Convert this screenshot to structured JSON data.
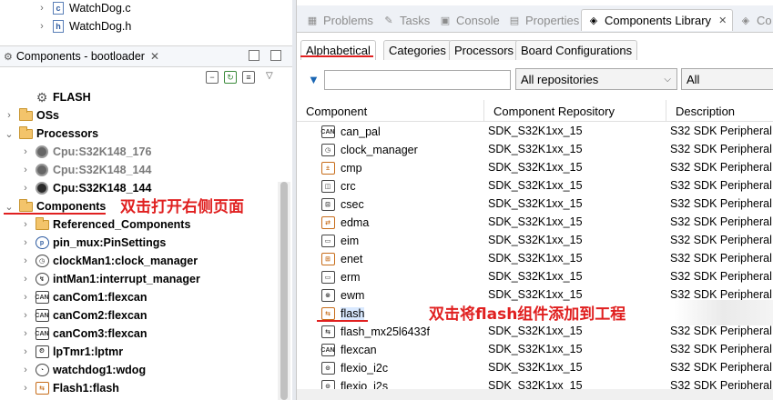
{
  "left_top_files": [
    {
      "label": "WatchDog.c",
      "icon": "c-file-icon",
      "glyph": "c"
    },
    {
      "label": "WatchDog.h",
      "icon": "h-file-icon",
      "glyph": "h"
    }
  ],
  "components_panel": {
    "title": "Components - bootloader",
    "close": "✕",
    "tree": [
      {
        "label": "FLASH",
        "icon": "gear-icon",
        "bold": true,
        "grey": false,
        "indent": 1,
        "chevron": ""
      },
      {
        "label": "OSs",
        "icon": "folder-icon",
        "bold": true,
        "grey": false,
        "indent": 0,
        "chevron": "›"
      },
      {
        "label": "Processors",
        "icon": "folder-icon",
        "bold": true,
        "grey": false,
        "indent": 0,
        "chevron": "⌄"
      },
      {
        "label": "Cpu:S32K148_176",
        "icon": "chip-icon",
        "bold": true,
        "grey": true,
        "indent": 1,
        "chevron": "›"
      },
      {
        "label": "Cpu:S32K148_144",
        "icon": "chip-icon",
        "bold": true,
        "grey": true,
        "indent": 1,
        "chevron": "›"
      },
      {
        "label": "Cpu:S32K148_144",
        "icon": "chip-icon",
        "bold": true,
        "grey": false,
        "indent": 1,
        "chevron": "›"
      },
      {
        "label": "Components",
        "icon": "folder-icon",
        "bold": true,
        "grey": false,
        "indent": 0,
        "chevron": "⌄"
      },
      {
        "label": "Referenced_Components",
        "icon": "folder-icon",
        "bold": true,
        "grey": false,
        "indent": 1,
        "chevron": "›"
      },
      {
        "label": "pin_mux:PinSettings",
        "icon": "pin-icon",
        "bold": true,
        "grey": false,
        "indent": 1,
        "chevron": "›"
      },
      {
        "label": "clockMan1:clock_manager",
        "icon": "clock-icon",
        "bold": true,
        "grey": false,
        "indent": 1,
        "chevron": "›"
      },
      {
        "label": "intMan1:interrupt_manager",
        "icon": "interrupt-icon",
        "bold": true,
        "grey": false,
        "indent": 1,
        "chevron": "›"
      },
      {
        "label": "canCom1:flexcan",
        "icon": "can-icon",
        "bold": true,
        "grey": false,
        "indent": 1,
        "chevron": "›"
      },
      {
        "label": "canCom2:flexcan",
        "icon": "can-icon",
        "bold": true,
        "grey": false,
        "indent": 1,
        "chevron": "›"
      },
      {
        "label": "canCom3:flexcan",
        "icon": "can-icon",
        "bold": true,
        "grey": false,
        "indent": 1,
        "chevron": "›"
      },
      {
        "label": "lpTmr1:lptmr",
        "icon": "timer-icon",
        "bold": true,
        "grey": false,
        "indent": 1,
        "chevron": "›"
      },
      {
        "label": "watchdog1:wdog",
        "icon": "watchdog-icon",
        "bold": true,
        "grey": false,
        "indent": 1,
        "chevron": "›"
      },
      {
        "label": "Flash1:flash",
        "icon": "flash-icon",
        "bold": true,
        "grey": false,
        "indent": 1,
        "chevron": "›"
      }
    ]
  },
  "view_tabs": [
    {
      "label": "Problems",
      "icon": "problems-icon",
      "active": false
    },
    {
      "label": "Tasks",
      "icon": "tasks-icon",
      "active": false
    },
    {
      "label": "Console",
      "icon": "console-icon",
      "active": false
    },
    {
      "label": "Properties",
      "icon": "properties-icon",
      "active": false
    },
    {
      "label": "Components Library",
      "icon": "components-library-icon",
      "active": true,
      "close": "✕"
    },
    {
      "label": "Co",
      "icon": "co-icon",
      "active": false
    }
  ],
  "sub_tabs": [
    "Alphabetical",
    "Categories",
    "Processors",
    "Board Configurations"
  ],
  "filter": {
    "text": "",
    "repository": "All repositories",
    "category": "All"
  },
  "table": {
    "headers": [
      "Component",
      "Component Repository",
      "Description"
    ],
    "rows": [
      {
        "name": "can_pal",
        "repo": "SDK_S32K1xx_15",
        "desc": "S32 SDK Peripheral",
        "icon": "can-icon",
        "badge": "CAN"
      },
      {
        "name": "clock_manager",
        "repo": "SDK_S32K1xx_15",
        "desc": "S32 SDK Peripheral",
        "icon": "clock-icon",
        "badge": "◷"
      },
      {
        "name": "cmp",
        "repo": "SDK_S32K1xx_15",
        "desc": "S32 SDK Peripheral",
        "icon": "cmp-icon",
        "badge": "±"
      },
      {
        "name": "crc",
        "repo": "SDK_S32K1xx_15",
        "desc": "S32 SDK Peripheral",
        "icon": "crc-icon",
        "badge": "◫"
      },
      {
        "name": "csec",
        "repo": "SDK_S32K1xx_15",
        "desc": "S32 SDK Peripheral",
        "icon": "csec-icon",
        "badge": "⊡"
      },
      {
        "name": "edma",
        "repo": "SDK_S32K1xx_15",
        "desc": "S32 SDK Peripheral",
        "icon": "edma-icon",
        "badge": "⇄"
      },
      {
        "name": "eim",
        "repo": "SDK_S32K1xx_15",
        "desc": "S32 SDK Peripheral",
        "icon": "eim-icon",
        "badge": "▭"
      },
      {
        "name": "enet",
        "repo": "SDK_S32K1xx_15",
        "desc": "S32 SDK Peripheral",
        "icon": "enet-icon",
        "badge": "⊞"
      },
      {
        "name": "erm",
        "repo": "SDK_S32K1xx_15",
        "desc": "S32 SDK Peripheral",
        "icon": "erm-icon",
        "badge": "▭"
      },
      {
        "name": "ewm",
        "repo": "SDK_S32K1xx_15",
        "desc": "S32 SDK Peripheral",
        "icon": "ewm-icon",
        "badge": "⊗"
      },
      {
        "name": "flash",
        "repo": "",
        "desc": "",
        "icon": "flash-icon",
        "badge": "⇆",
        "selected": true
      },
      {
        "name": "flash_mx25l6433f",
        "repo": "SDK_S32K1xx_15",
        "desc": "S32 SDK Peripheral",
        "icon": "flash-mx-icon",
        "badge": "⇆"
      },
      {
        "name": "flexcan",
        "repo": "SDK_S32K1xx_15",
        "desc": "S32 SDK Peripheral",
        "icon": "can-icon",
        "badge": "CAN"
      },
      {
        "name": "flexio_i2c",
        "repo": "SDK_S32K1xx_15",
        "desc": "S32 SDK Peripheral",
        "icon": "flexio-icon",
        "badge": "⊙"
      },
      {
        "name": "flexio_i2s",
        "repo": "SDK_S32K1xx_15",
        "desc": "S32 SDK Peripheral",
        "icon": "flexio-icon",
        "badge": "⊙"
      }
    ]
  },
  "annotations": {
    "components_hint": "双击打开右侧页面",
    "flash_hint": "双击将flash组件添加到工程"
  },
  "colors": {
    "annotation_red": "#e02020",
    "selection_blue": "#d9e9ff"
  }
}
